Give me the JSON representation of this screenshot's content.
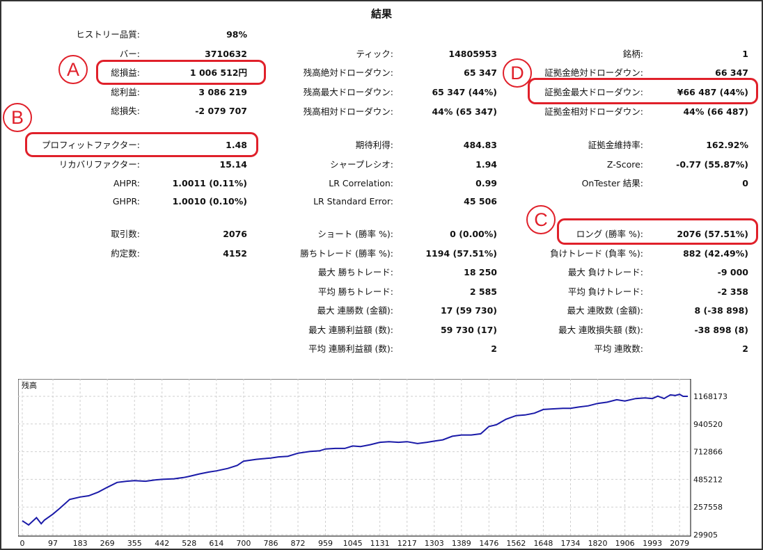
{
  "title": "結果",
  "col1": [
    {
      "label": "ヒストリー品質:",
      "value": "98%"
    },
    {
      "label": "バー:",
      "value": "3710632"
    },
    {
      "label": "総損益:",
      "value": "1 006 512円"
    },
    {
      "label": "総利益:",
      "value": "3 086 219"
    },
    {
      "label": "総損失:",
      "value": "-2 079 707"
    },
    {
      "label": "プロフィットファクター:",
      "value": "1.48"
    },
    {
      "label": "リカバリファクター:",
      "value": "15.14"
    },
    {
      "label": "AHPR:",
      "value": "1.0011 (0.11%)"
    },
    {
      "label": "GHPR:",
      "value": "1.0010 (0.10%)"
    },
    {
      "label": "取引数:",
      "value": "2076"
    },
    {
      "label": "約定数:",
      "value": "4152"
    }
  ],
  "col2": [
    {
      "label": "ティック:",
      "value": "14805953"
    },
    {
      "label": "残高絶対ドローダウン:",
      "value": "65 347"
    },
    {
      "label": "残高最大ドローダウン:",
      "value": "65 347 (44%)"
    },
    {
      "label": "残高相対ドローダウン:",
      "value": "44% (65 347)"
    },
    {
      "label": "期待利得:",
      "value": "484.83"
    },
    {
      "label": "シャープレシオ:",
      "value": "1.94"
    },
    {
      "label": "LR Correlation:",
      "value": "0.99"
    },
    {
      "label": "LR Standard Error:",
      "value": "45 506"
    },
    {
      "label": "ショート (勝率 %):",
      "value": "0 (0.00%)"
    },
    {
      "label": "勝ちトレード (勝率 %):",
      "value": "1194 (57.51%)"
    },
    {
      "label": "最大 勝ちトレード:",
      "value": "18 250"
    },
    {
      "label": "平均 勝ちトレード:",
      "value": "2 585"
    },
    {
      "label": "最大 連勝数 (金額):",
      "value": "17 (59 730)"
    },
    {
      "label": "最大 連勝利益額 (数):",
      "value": "59 730 (17)"
    },
    {
      "label": "平均 連勝利益額 (数):",
      "value": "2"
    }
  ],
  "col3": [
    {
      "label": "銘柄:",
      "value": "1"
    },
    {
      "label": "証拠金絶対ドローダウン:",
      "value": "66 347"
    },
    {
      "label": "証拠金最大ドローダウン:",
      "value": "¥66 487 (44%)"
    },
    {
      "label": "証拠金相対ドローダウン:",
      "value": "44% (66 487)"
    },
    {
      "label": "証拠金維持率:",
      "value": "162.92%"
    },
    {
      "label": "Z-Score:",
      "value": "-0.77 (55.87%)"
    },
    {
      "label": "OnTester 結果:",
      "value": "0"
    },
    {
      "label": "ロング (勝率 %):",
      "value": "2076 (57.51%)"
    },
    {
      "label": "負けトレード (負率 %):",
      "value": "882 (42.49%)"
    },
    {
      "label": "最大 負けトレード:",
      "value": "-9 000"
    },
    {
      "label": "平均 負けトレード:",
      "value": "-2 358"
    },
    {
      "label": "最大 連敗数 (金額):",
      "value": "8 (-38 898)"
    },
    {
      "label": "最大 連敗損失額 (数):",
      "value": "-38 898 (8)"
    },
    {
      "label": "平均 連敗数:",
      "value": "2"
    }
  ],
  "markers": {
    "a": "A",
    "b": "B",
    "c": "C",
    "d": "D"
  },
  "colors": {
    "highlight": "#e0202a",
    "line": "#1a1aa8",
    "grid": "#cfcfcf"
  },
  "chart_data": {
    "type": "line",
    "title": "残高",
    "series": [
      {
        "x": [
          0,
          20,
          45,
          60,
          70,
          97,
          120,
          150,
          183,
          210,
          240,
          269,
          300,
          330,
          355,
          390,
          420,
          442,
          480,
          510,
          528,
          560,
          590,
          614,
          650,
          680,
          700,
          740,
          760,
          786,
          810,
          840,
          872,
          910,
          940,
          959,
          990,
          1020,
          1045,
          1070,
          1100,
          1131,
          1160,
          1190,
          1217,
          1250,
          1280,
          1303,
          1330,
          1360,
          1389,
          1420,
          1450,
          1476,
          1500,
          1530,
          1562,
          1590,
          1620,
          1648,
          1680,
          1710,
          1734,
          1760,
          1790,
          1820,
          1850,
          1880,
          1906,
          1940,
          1970,
          1993,
          2010,
          2030,
          2050,
          2065,
          2079,
          2090,
          2105
        ],
        "values": [
          145000,
          110000,
          170000,
          120000,
          150000,
          200000,
          250000,
          320000,
          340000,
          350000,
          380000,
          420000,
          460000,
          470000,
          475000,
          470000,
          480000,
          485000,
          490000,
          500000,
          510000,
          530000,
          545000,
          555000,
          575000,
          600000,
          635000,
          650000,
          655000,
          660000,
          670000,
          675000,
          700000,
          715000,
          720000,
          735000,
          740000,
          740000,
          760000,
          755000,
          770000,
          790000,
          795000,
          790000,
          795000,
          780000,
          790000,
          800000,
          810000,
          840000,
          850000,
          850000,
          860000,
          920000,
          935000,
          980000,
          1010000,
          1015000,
          1030000,
          1060000,
          1065000,
          1070000,
          1070000,
          1080000,
          1090000,
          1110000,
          1120000,
          1140000,
          1130000,
          1150000,
          1155000,
          1150000,
          1170000,
          1150000,
          1180000,
          1175000,
          1185000,
          1168173,
          1168173
        ]
      }
    ],
    "y_ticks": [
      "1168173",
      "940520",
      "712866",
      "485212",
      "257558",
      "29905"
    ],
    "x_ticks": [
      "0",
      "97",
      "183",
      "269",
      "355",
      "442",
      "528",
      "614",
      "700",
      "786",
      "872",
      "959",
      "1045",
      "1131",
      "1217",
      "1303",
      "1389",
      "1476",
      "1562",
      "1648",
      "1734",
      "1820",
      "1906",
      "1993",
      "2079"
    ],
    "ylim": [
      29905,
      1168173
    ],
    "xlim": [
      0,
      2105
    ],
    "grid": true
  }
}
